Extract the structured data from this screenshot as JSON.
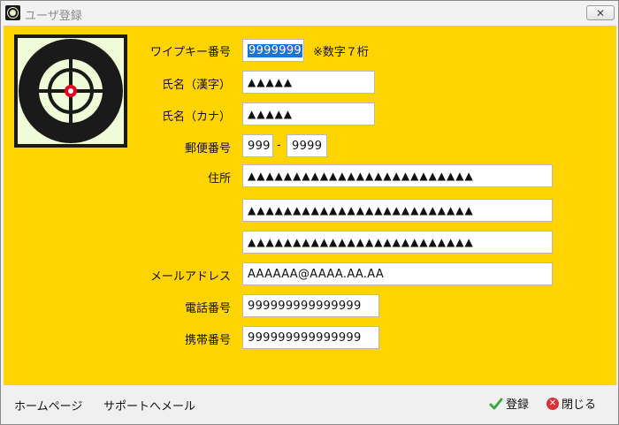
{
  "window": {
    "title": "ユーザ登録",
    "close_glyph": "✕"
  },
  "form": {
    "wipe_key": {
      "label": "ワイプキー番号",
      "value": "9999999",
      "note": "※数字７桁"
    },
    "name_kanji": {
      "label": "氏名（漢字）",
      "value": "▲▲▲▲▲"
    },
    "name_kana": {
      "label": "氏名（カナ）",
      "value": "▲▲▲▲▲"
    },
    "postal": {
      "label": "郵便番号",
      "value1": "999",
      "separator": "-",
      "value2": "9999"
    },
    "address": {
      "label": "住所",
      "line1": "▲▲▲▲▲▲▲▲▲▲▲▲▲▲▲▲▲▲▲▲▲▲▲▲▲",
      "line2": "▲▲▲▲▲▲▲▲▲▲▲▲▲▲▲▲▲▲▲▲▲▲▲▲▲",
      "line3": "▲▲▲▲▲▲▲▲▲▲▲▲▲▲▲▲▲▲▲▲▲▲▲▲▲"
    },
    "email": {
      "label": "メールアドレス",
      "value": "AAAAAA@AAAA.AA.AA"
    },
    "phone": {
      "label": "電話番号",
      "value": "999999999999999"
    },
    "mobile": {
      "label": "携帯番号",
      "value": "999999999999999"
    }
  },
  "footer": {
    "homepage_link": "ホームページ",
    "support_link": "サポートへメール",
    "register_label": "登録",
    "close_label": "閉じる"
  },
  "colors": {
    "form_bg": "#ffd400",
    "logo_bg": "#f0fbd8",
    "accent_red": "#e8001e",
    "selection": "#1e74d2"
  }
}
